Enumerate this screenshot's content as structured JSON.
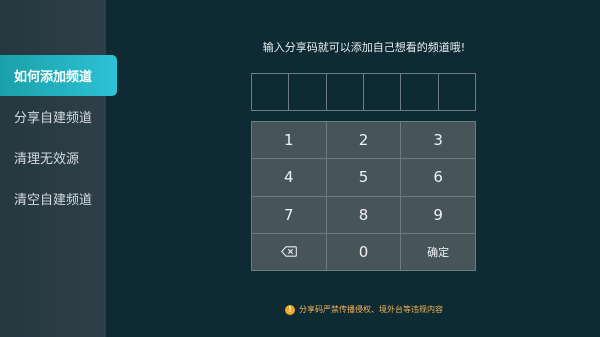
{
  "sidebar": {
    "items": [
      {
        "label": "如何添加频道",
        "active": true
      },
      {
        "label": "分享自建频道",
        "active": false
      },
      {
        "label": "清理无效源",
        "active": false
      },
      {
        "label": "清空自建频道",
        "active": false
      }
    ]
  },
  "main": {
    "title": "输入分享码就可以添加自己想看的频道哦!",
    "code_box_count": 6,
    "keypad": {
      "k1": "1",
      "k2": "2",
      "k3": "3",
      "k4": "4",
      "k5": "5",
      "k6": "6",
      "k7": "7",
      "k8": "8",
      "k9": "9",
      "backspace_icon": "backspace-icon",
      "k0": "0",
      "confirm": "确定"
    },
    "warning": {
      "icon": "exclamation-icon",
      "icon_glyph": "!",
      "text": "分享码严禁传播侵权、境外台等违规内容"
    }
  },
  "colors": {
    "background": "#0e2a33",
    "sidebar": "#2b3c45",
    "accent": "#1fb0bd",
    "key": "#47545a",
    "warning": "#f5a623"
  }
}
